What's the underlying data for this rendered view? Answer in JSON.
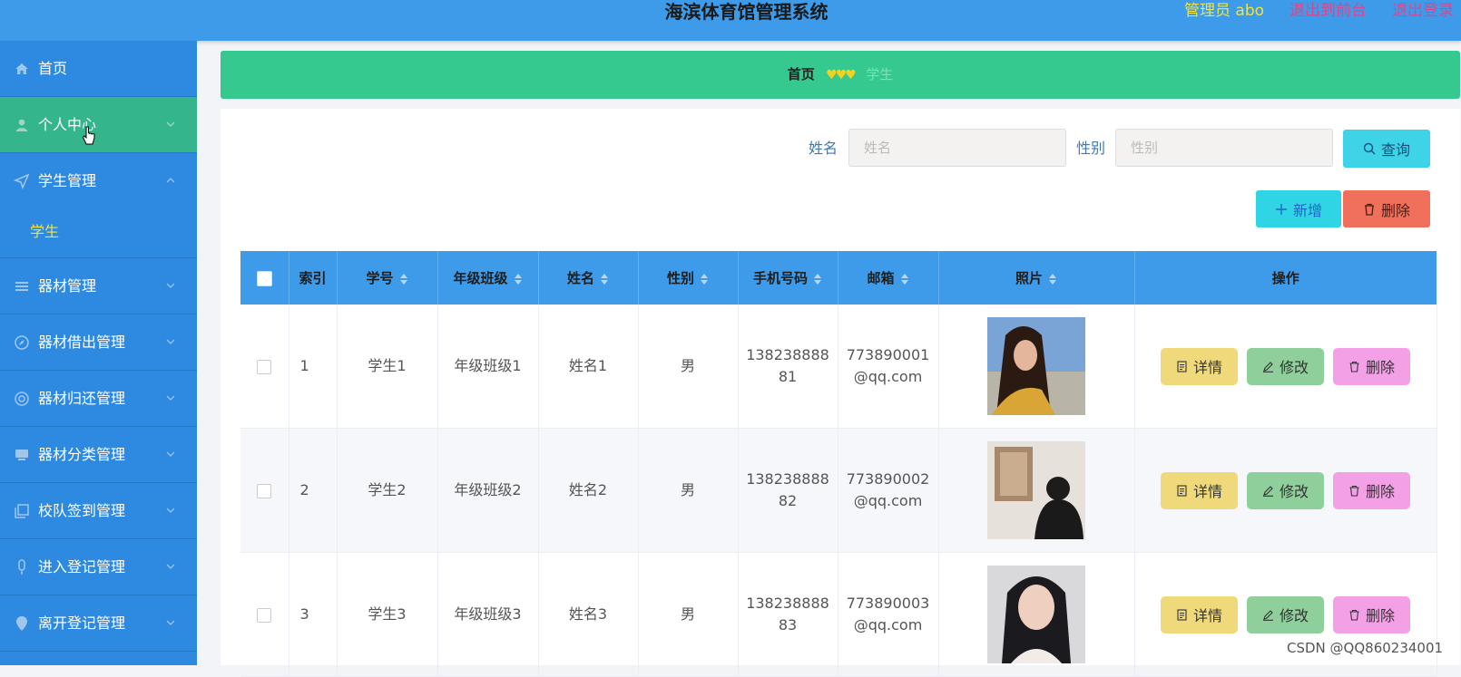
{
  "header": {
    "title": "海滨体育馆管理系统",
    "admin_label": "管理员 abo",
    "back_to_front": "退出到前台",
    "logout": "退出登录"
  },
  "sidebar": {
    "items": [
      {
        "label": "首页",
        "icon": "home-icon"
      },
      {
        "label": "个人中心",
        "icon": "user-icon"
      },
      {
        "label": "学生管理",
        "icon": "navigation-icon"
      },
      {
        "label": "器材管理",
        "icon": "menu-icon"
      },
      {
        "label": "器材借出管理",
        "icon": "compass-icon"
      },
      {
        "label": "器材归还管理",
        "icon": "lifebuoy-icon"
      },
      {
        "label": "器材分类管理",
        "icon": "monitor-icon"
      },
      {
        "label": "校队签到管理",
        "icon": "copy-icon"
      },
      {
        "label": "进入登记管理",
        "icon": "microphone-icon"
      },
      {
        "label": "离开登记管理",
        "icon": "location-icon"
      }
    ],
    "sub_items": [
      {
        "label": "学生"
      }
    ]
  },
  "breadcrumb": {
    "home": "首页",
    "separator": "♥♥♥",
    "current": "学生"
  },
  "search": {
    "name_label": "姓名",
    "name_placeholder": "姓名",
    "gender_label": "性别",
    "gender_placeholder": "性别",
    "query_button": "查询"
  },
  "toolbar": {
    "add_label": "新增",
    "delete_label": "删除"
  },
  "table": {
    "columns": [
      "索引",
      "学号",
      "年级班级",
      "姓名",
      "性别",
      "手机号码",
      "邮箱",
      "照片",
      "操作"
    ],
    "rows": [
      {
        "index": "1",
        "student_no": "学生1",
        "grade_class": "年级班级1",
        "name": "姓名1",
        "gender": "男",
        "phone_a": "138238888",
        "phone_b": "81",
        "email_a": "773890001",
        "email_b": "@qq.com"
      },
      {
        "index": "2",
        "student_no": "学生2",
        "grade_class": "年级班级2",
        "name": "姓名2",
        "gender": "男",
        "phone_a": "138238888",
        "phone_b": "82",
        "email_a": "773890002",
        "email_b": "@qq.com"
      },
      {
        "index": "3",
        "student_no": "学生3",
        "grade_class": "年级班级3",
        "name": "姓名3",
        "gender": "男",
        "phone_a": "138238888",
        "phone_b": "83",
        "email_a": "773890003",
        "email_b": "@qq.com"
      }
    ],
    "actions": {
      "detail": "详情",
      "edit": "修改",
      "delete": "删除"
    }
  },
  "watermark": "CSDN @QQ860234001",
  "colors": {
    "topbar": "#3d9be9",
    "sidebar": "#2e8ae0",
    "active_item": "#35b58b",
    "breadcrumb": "#35c88f",
    "highlight_yellow": "#f2e23f",
    "link_pink": "#e0458a"
  }
}
